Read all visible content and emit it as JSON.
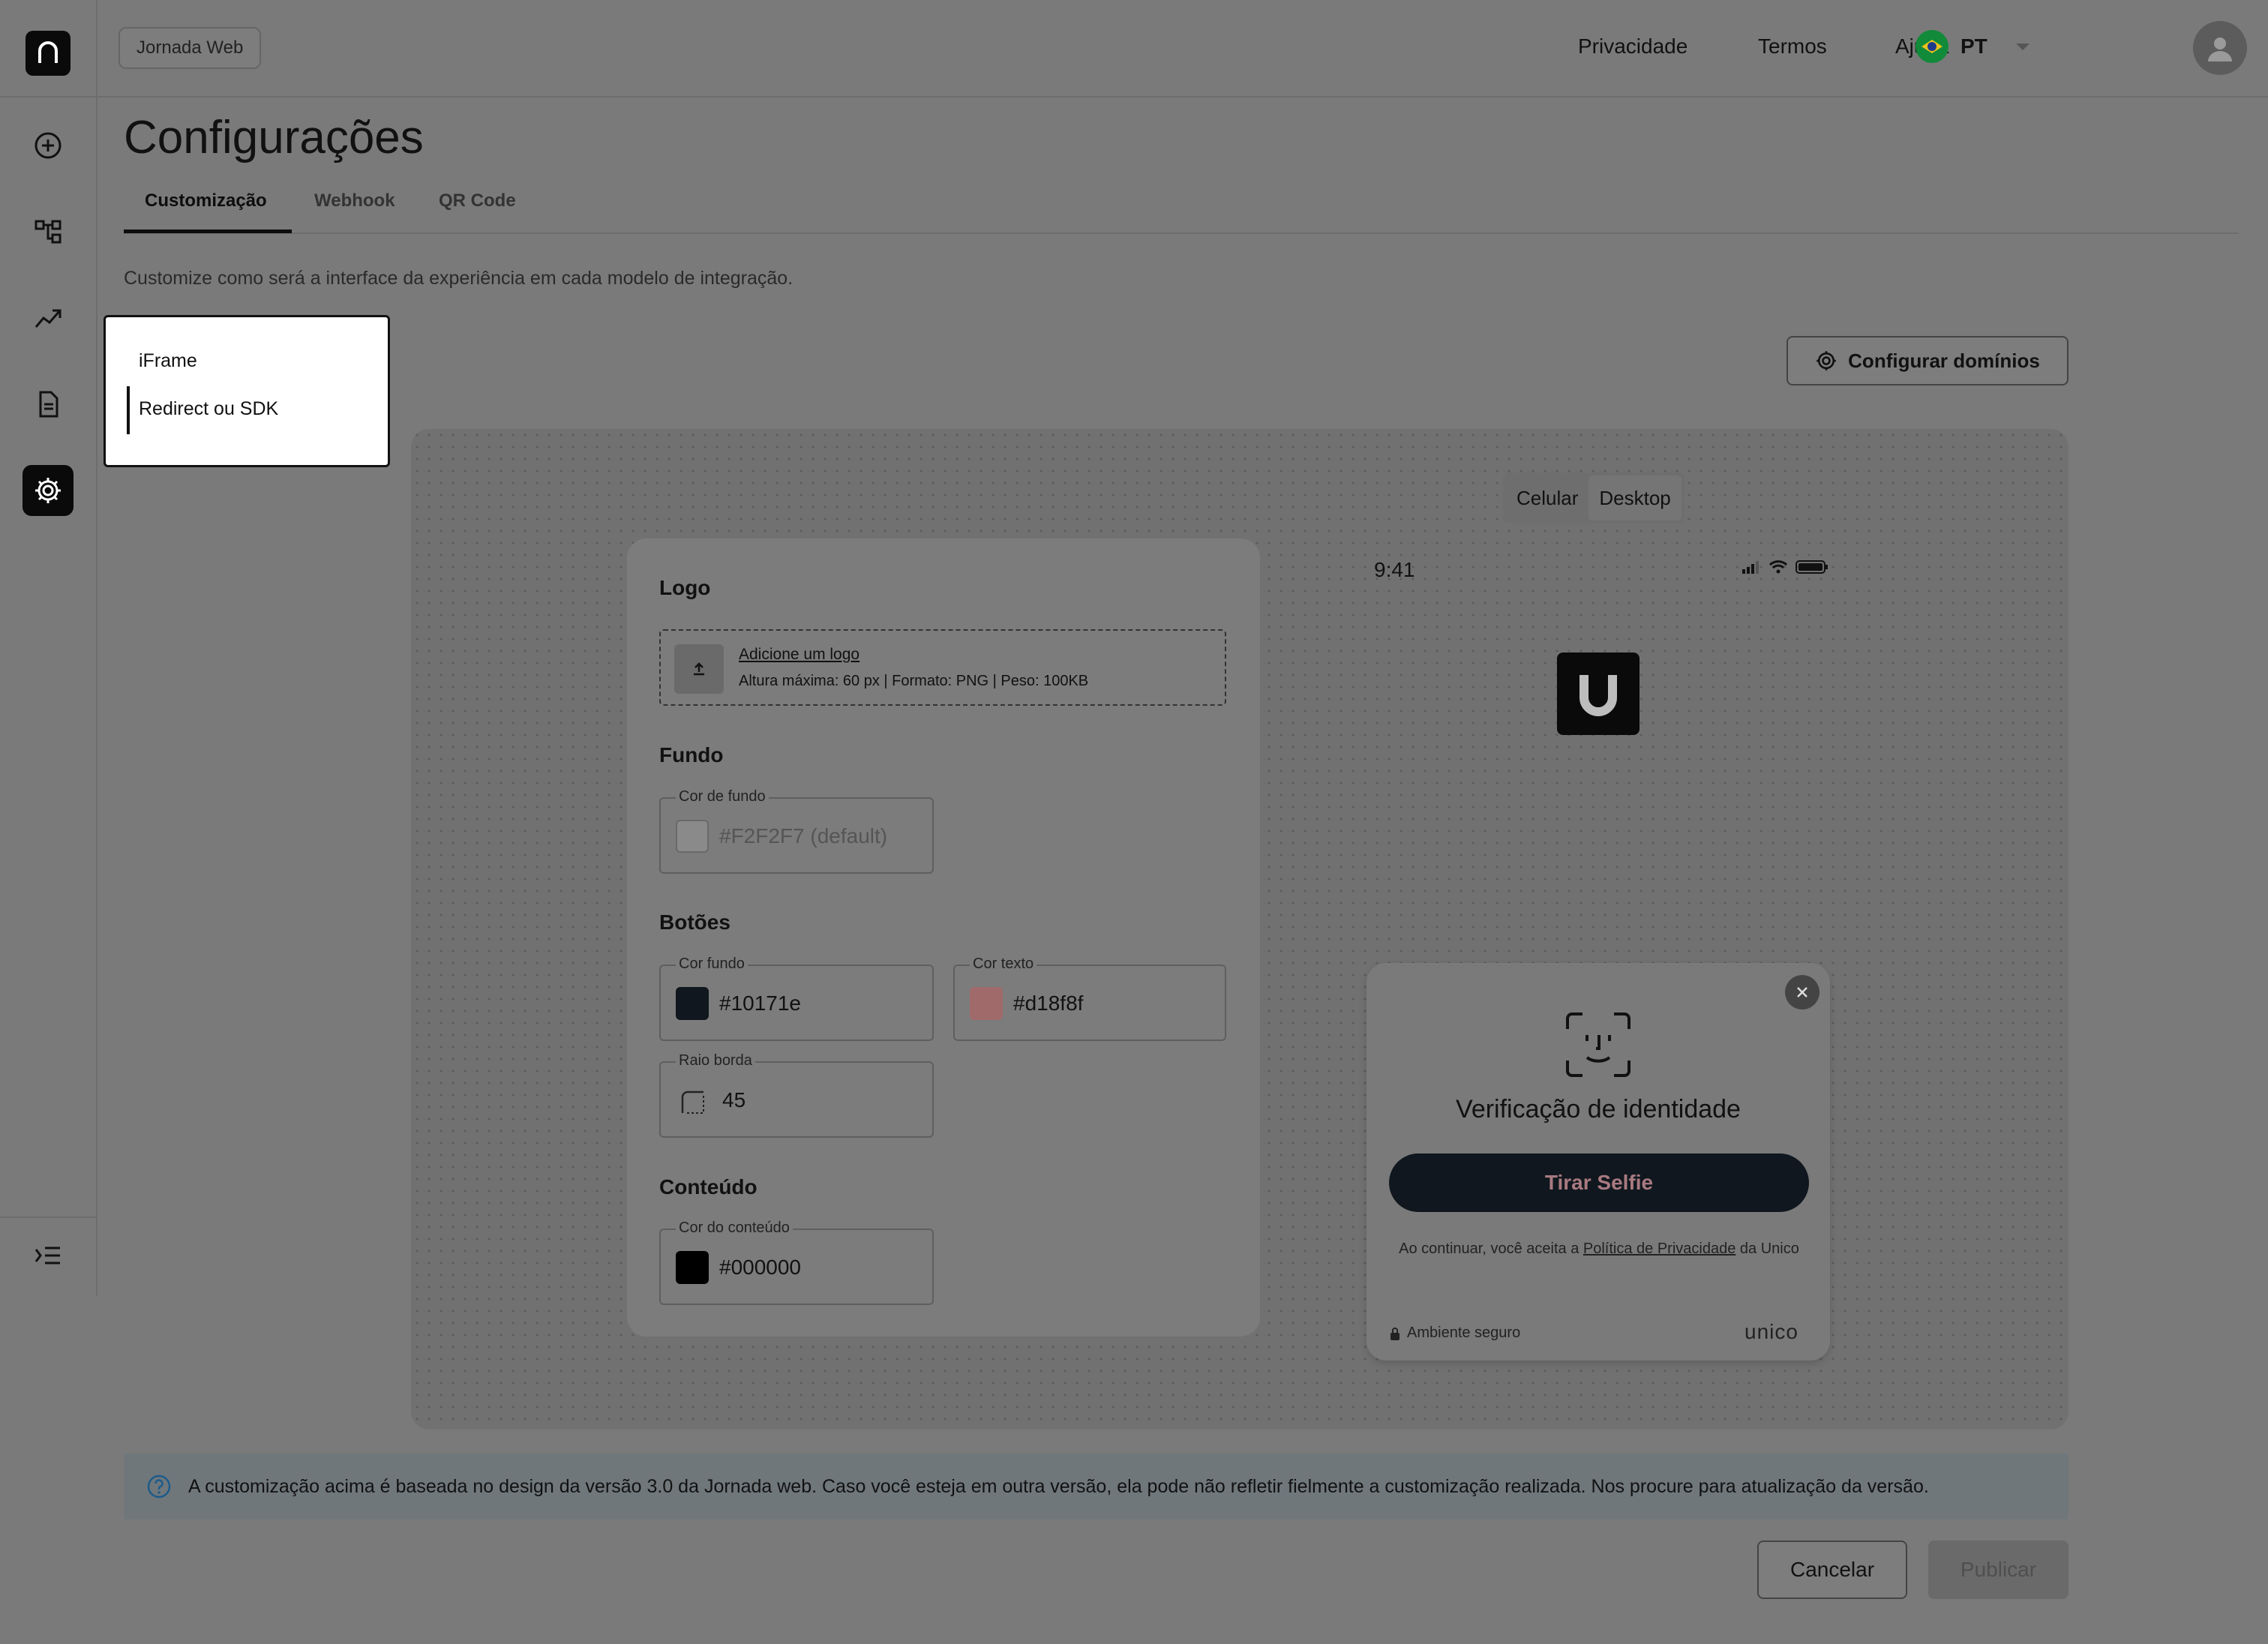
{
  "header": {
    "env_badge": "Jornada Web",
    "links": [
      "Privacidade",
      "Termos",
      "Ajuda"
    ],
    "language": "PT"
  },
  "page": {
    "title": "Configurações",
    "tabs": [
      "Customização",
      "Webhook",
      "QR Code"
    ],
    "subtitle": "Customize como será a interface da experiência em cada modelo de integração."
  },
  "mode_menu": {
    "items": [
      "iFrame",
      "Redirect ou SDK"
    ],
    "selected": "Redirect ou SDK"
  },
  "config_domains_label": "Configurar domínios",
  "form": {
    "logo": {
      "title": "Logo",
      "upload_link": "Adicione um logo",
      "upload_hint": "Altura máxima: 60 px | Formato: PNG | Peso: 100KB"
    },
    "background": {
      "title": "Fundo",
      "label": "Cor de fundo",
      "placeholder": "#F2F2F7 (default)"
    },
    "buttons": {
      "title": "Botões",
      "bg_label": "Cor fundo",
      "bg_value": "#10171e",
      "text_label": "Cor texto",
      "text_value": "#d18f8f",
      "radius_label": "Raio borda",
      "radius_value": "45"
    },
    "content": {
      "title": "Conteúdo",
      "label": "Cor do conteúdo",
      "value": "#000000"
    }
  },
  "preview": {
    "device_options": [
      "Celular",
      "Desktop"
    ],
    "time": "9:41",
    "card_title": "Verificação de identidade",
    "selfie_button": "Tirar Selfie",
    "consent_prefix": "Ao continuar, você aceita a ",
    "consent_link": "Política de Privacidade",
    "consent_suffix": " da Unico",
    "secure_label": "Ambiente seguro",
    "brand": "unico"
  },
  "info_banner": "A customização acima é baseada no design da versão 3.0 da Jornada web. Caso você esteja em outra versão, ela pode não refletir fielmente a customização realizada. Nos procure para atualização da versão.",
  "footer": {
    "cancel": "Cancelar",
    "publish": "Publicar"
  },
  "colors": {
    "button_bg": "#10171e",
    "button_text": "#d18f8f",
    "content": "#000000",
    "background_default": "#F2F2F7"
  }
}
